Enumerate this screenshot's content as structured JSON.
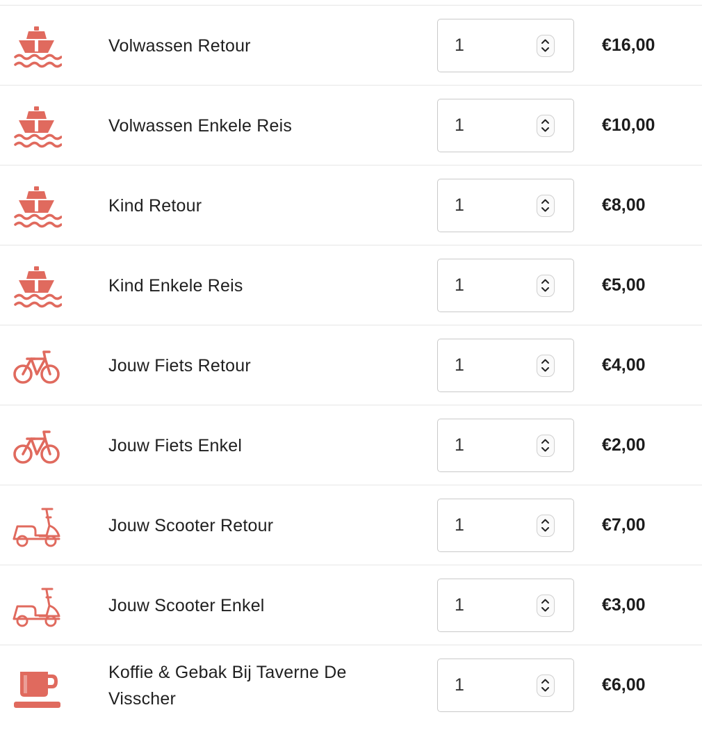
{
  "accent_color": "#e06a5e",
  "items": [
    {
      "icon": "ferry-icon",
      "label": "Volwassen Retour",
      "quantity": "1",
      "price": "€16,00"
    },
    {
      "icon": "ferry-icon",
      "label": "Volwassen Enkele Reis",
      "quantity": "1",
      "price": "€10,00"
    },
    {
      "icon": "ferry-icon",
      "label": "Kind Retour",
      "quantity": "1",
      "price": "€8,00"
    },
    {
      "icon": "ferry-icon",
      "label": "Kind Enkele Reis",
      "quantity": "1",
      "price": "€5,00"
    },
    {
      "icon": "bicycle-icon",
      "label": "Jouw Fiets Retour",
      "quantity": "1",
      "price": "€4,00"
    },
    {
      "icon": "bicycle-icon",
      "label": "Jouw Fiets Enkel",
      "quantity": "1",
      "price": "€2,00"
    },
    {
      "icon": "scooter-icon",
      "label": "Jouw Scooter Retour",
      "quantity": "1",
      "price": "€7,00"
    },
    {
      "icon": "scooter-icon",
      "label": "Jouw Scooter Enkel",
      "quantity": "1",
      "price": "€3,00"
    },
    {
      "icon": "coffee-cup-icon",
      "label": "Koffie & Gebak Bij Taverne De Visscher",
      "quantity": "1",
      "price": "€6,00"
    }
  ]
}
